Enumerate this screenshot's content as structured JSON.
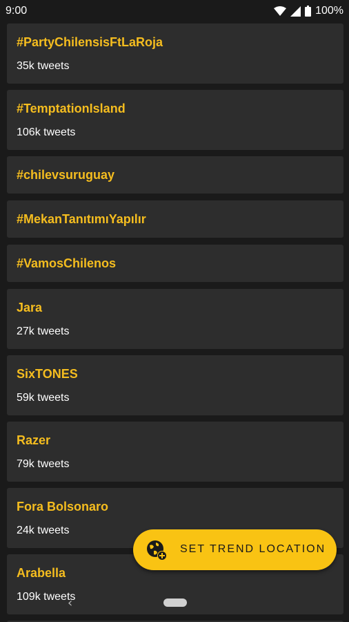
{
  "status_bar": {
    "time": "9:00",
    "battery_percent": "100%",
    "icons": [
      "wifi-icon",
      "signal-icon",
      "battery-icon"
    ]
  },
  "trends": [
    {
      "name": "#PartyChilensisFtLaRoja",
      "count": "35k tweets"
    },
    {
      "name": "#TemptationIsland",
      "count": "106k tweets"
    },
    {
      "name": "#chilevsuruguay",
      "count": null
    },
    {
      "name": "#MekanTanıtımıYapılır",
      "count": null
    },
    {
      "name": "#VamosChilenos",
      "count": null
    },
    {
      "name": "Jara",
      "count": "27k tweets"
    },
    {
      "name": "SixTONES",
      "count": "59k tweets"
    },
    {
      "name": "Razer",
      "count": "79k tweets"
    },
    {
      "name": "Fora Bolsonaro",
      "count": "24k tweets"
    },
    {
      "name": "Arabella",
      "count": "109k tweets"
    }
  ],
  "fab": {
    "label": "SET TREND LOCATION",
    "icon": "globe-add-icon"
  },
  "nav": {
    "back_glyph": "‹",
    "icons": [
      "back-icon",
      "home-pill"
    ]
  },
  "colors": {
    "background": "#1a1a1a",
    "card": "#2d2d2d",
    "accent": "#f5bd1f",
    "fab": "#f9c313",
    "text": "#ffffff"
  }
}
